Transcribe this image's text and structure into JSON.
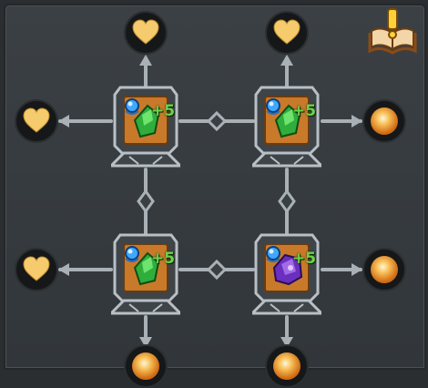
{
  "colors": {
    "heart": "#f6cb6e",
    "orb": "#f5a23a",
    "green_gem": "#39c94a",
    "purple_gem": "#8a3fd8",
    "blue_orb": "#3fa8ff",
    "bonus_text": "#6ed14a"
  },
  "nodes": [
    {
      "gem": "green",
      "bonus": "+5"
    },
    {
      "gem": "green",
      "bonus": "+5"
    },
    {
      "gem": "green",
      "bonus": "+5"
    },
    {
      "gem": "purple",
      "bonus": "+5"
    }
  ],
  "rewards": {
    "top_left": "heart-icon",
    "top_right": "heart-icon",
    "left_upper": "heart-icon",
    "left_lower": "heart-icon",
    "right_upper": "orb-icon",
    "right_lower": "orb-icon",
    "bottom_left": "orb-icon",
    "bottom_right": "orb-icon"
  },
  "quest_button_icon": "quest-book-icon"
}
